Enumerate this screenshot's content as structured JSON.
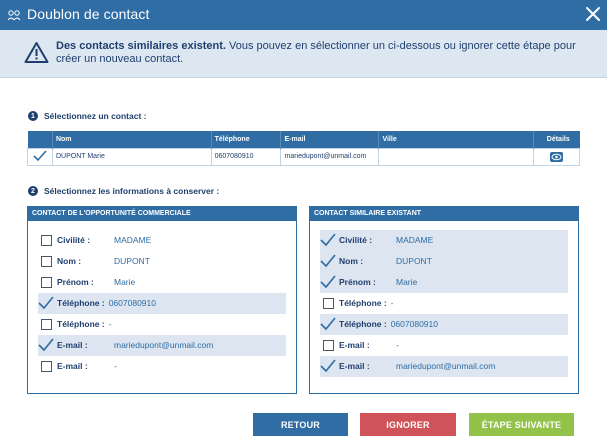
{
  "window": {
    "title": "Doublon de contact",
    "title_icon": "contacts-swap-icon",
    "close_icon": "close-icon"
  },
  "banner": {
    "icon": "warning-icon",
    "bold": "Des contacts similaires existent.",
    "text": " Vous pouvez en sélectionner un ci-dessous ou ignorer cette étape pour créer un nouveau contact."
  },
  "step1": {
    "number": "1",
    "title": "Sélectionnez un contact :"
  },
  "contacts_table": {
    "headers": [
      "",
      "Nom",
      "Téléphone",
      "E-mail",
      "Ville",
      "Détails"
    ],
    "rows": [
      {
        "selected": true,
        "nom": "DUPONT Marie",
        "telephone": "0607080910",
        "email": "mariedupont@unmail.com",
        "ville": "",
        "details_icon": "eye-icon"
      }
    ]
  },
  "step2": {
    "number": "2",
    "title": "Sélectionnez les informations à conserver :"
  },
  "left_panel": {
    "title": "CONTACT DE L'OPPORTUNITÉ COMMERCIALE",
    "fields": [
      {
        "label": "Civilité :",
        "value": "MADAME",
        "checked": false,
        "highlighted": false
      },
      {
        "label": "Nom :",
        "value": "DUPONT",
        "checked": false,
        "highlighted": false
      },
      {
        "label": "Prénom :",
        "value": "Marie",
        "checked": false,
        "highlighted": false
      },
      {
        "label": "Téléphone :",
        "value": "0607080910",
        "checked": true,
        "highlighted": true
      },
      {
        "label": "Téléphone :",
        "value": "-",
        "checked": false,
        "highlighted": false
      },
      {
        "label": "E-mail :",
        "value": "mariedupont@unmail.com",
        "checked": true,
        "highlighted": true
      },
      {
        "label": "E-mail :",
        "value": "-",
        "checked": false,
        "highlighted": false
      }
    ]
  },
  "right_panel": {
    "title": "CONTACT SIMILAIRE EXISTANT",
    "fields": [
      {
        "label": "Civilité :",
        "value": "MADAME",
        "checked": true,
        "highlighted": true
      },
      {
        "label": "Nom :",
        "value": "DUPONT",
        "checked": true,
        "highlighted": true
      },
      {
        "label": "Prénom :",
        "value": "Marie",
        "checked": true,
        "highlighted": true
      },
      {
        "label": "Téléphone :",
        "value": "-",
        "checked": false,
        "highlighted": false
      },
      {
        "label": "Téléphone :",
        "value": "0607080910",
        "checked": true,
        "highlighted": true
      },
      {
        "label": "E-mail :",
        "value": "-",
        "checked": false,
        "highlighted": false
      },
      {
        "label": "E-mail :",
        "value": "mariedupont@unmail.com",
        "checked": true,
        "highlighted": true
      }
    ]
  },
  "buttons": {
    "retour": "RETOUR",
    "ignorer": "IGNORER",
    "suivante": "ÉTAPE SUIVANTE"
  },
  "colors": {
    "primary": "#2f6da4",
    "danger": "#cf5359",
    "success": "#92c24a",
    "banner_bg": "#dde7f2",
    "highlight_row": "#dce5f0"
  }
}
